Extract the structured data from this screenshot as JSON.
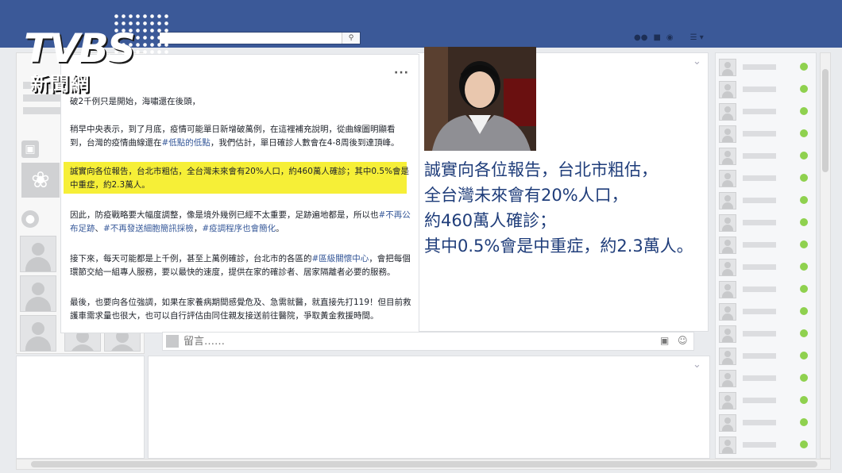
{
  "logo": {
    "main": "TVBS",
    "sub": "新聞網"
  },
  "search": {
    "placeholder": "",
    "button_icon": "search-icon"
  },
  "post": {
    "menu": "···",
    "p1": "破2千例只是開始，海嘯還在後頭，",
    "p2_a": "稍早中央表示，到了月底，疫情可能單日新增破萬例，在這裡補充說明，從曲線圖明顯看到，台灣的疫情曲線還在",
    "p2_tag": "#低點的低點",
    "p2_b": "，我們估計，單日確診人數會在4-8周後到達頂峰。",
    "p3": "誠實向各位報告，台北市粗估，全台灣未來會有20%人口，約460萬人確診；其中0.5%會是中重症，約2.3萬人。",
    "p4_a": "因此，防疫戰略要大幅度調整，像是境外幾例已經不太重要，足跡遍地都是，所以也",
    "p4_tag1": "#不再公布足跡",
    "p4_b": "、",
    "p4_tag2": "#不再發送細胞簡訊採檢",
    "p4_c": "，",
    "p4_tag3": "#疫調程序也會簡化",
    "p4_d": "。",
    "p5_a": "接下來，每天可能都是上千例，甚至上萬例確診，台北市的各區的",
    "p5_tag": "#區級關懷中心",
    "p5_b": "，會把每個環節交給一組專人服務，要以最快的速度，提供在家的確診者、居家隔離者必要的服務。",
    "p6": "最後，也要向各位強調，如果在家養病期間感覺危及、急需就醫，就直接先打119！但目前救護車需求量也很大，也可以自行評估由同住親友接送前往醫院，爭取黃金救援時間。"
  },
  "quote": {
    "line1": "誠實向各位報告，台北市粗估，",
    "line2": "全台灣未來會有20%人口，",
    "line3": "約460萬人確診；",
    "line4": "其中0.5%會是中重症，約2.3萬人。"
  },
  "comment": {
    "placeholder": "留言……"
  },
  "colors": {
    "brand": "#3b5998",
    "highlight": "#f6ef37",
    "quote": "#1f3d7a",
    "online": "#8fd14f"
  }
}
